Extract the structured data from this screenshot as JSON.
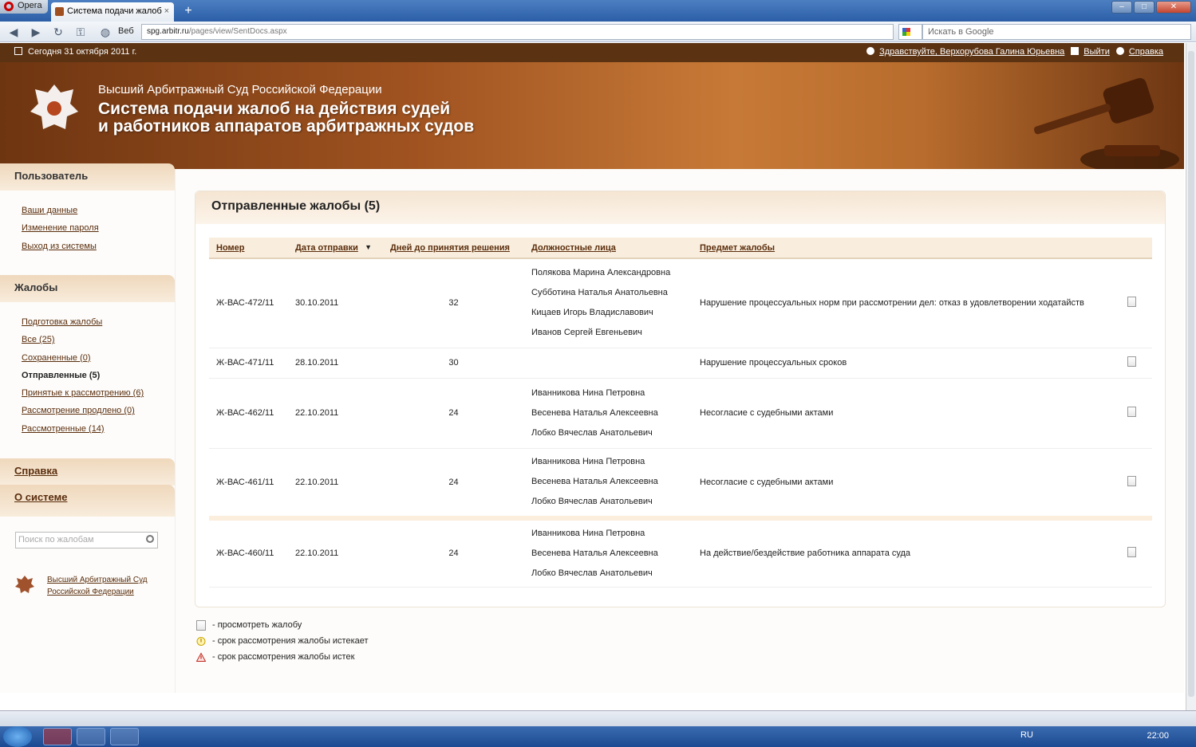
{
  "browser": {
    "menu_label": "Opera",
    "tab_title": "Система подачи жалоб",
    "web_label": "Веб",
    "url_host": "spg.arbitr.ru",
    "url_path": "/pages/view/SentDocs.aspx",
    "search_placeholder": "Искать в Google"
  },
  "topbar": {
    "date": "Сегодня 31 октября 2011 г.",
    "greeting": "Здравствуйте, Верхорубова Галина Юрьевна",
    "logout": "Выйти",
    "help": "Справка"
  },
  "banner": {
    "court": "Высший Арбитражный Суд Российской Федерации",
    "title_line1": "Система подачи жалоб на действия судей",
    "title_line2": "и работников аппаратов арбитражных судов"
  },
  "sidebar": {
    "user_header": "Пользователь",
    "user_links": [
      "Ваши данные",
      "Изменение пароля",
      "Выход из системы"
    ],
    "complaints_header": "Жалобы",
    "complaint_links": [
      "Подготовка жалобы",
      "Все (25)",
      "Сохраненные (0)",
      "Отправленные (5)",
      "Принятые к рассмотрению (6)",
      "Рассмотрение продлено (0)",
      "Рассмотренные (14)"
    ],
    "help_header": "Справка",
    "about_header": "О системе",
    "search_placeholder": "Поиск по жалобам",
    "court_link_line1": "Высший Арбитражный Суд",
    "court_link_line2": "Российской Федерации"
  },
  "panel": {
    "title": "Отправленные жалобы (5)",
    "columns": [
      "Номер",
      "Дата отправки",
      "Дней до принятия решения",
      "Должностные лица",
      "Предмет жалобы"
    ],
    "sort_indicator": "▼",
    "rows": [
      {
        "number": "Ж-ВАС-472/11",
        "date": "30.10.2011",
        "days": "32",
        "officials": [
          "Полякова Марина Александровна",
          "Субботина Наталья Анатольевна",
          "Кицаев Игорь Владиславович",
          "Иванов Сергей Евгеньевич"
        ],
        "subject": "Нарушение процессуальных норм при рассмотрении дел: отказ в удовлетворении ходатайств"
      },
      {
        "number": "Ж-ВАС-471/11",
        "date": "28.10.2011",
        "days": "30",
        "officials": [],
        "subject": "Нарушение процессуальных сроков"
      },
      {
        "number": "Ж-ВАС-462/11",
        "date": "22.10.2011",
        "days": "24",
        "officials": [
          "Иванникова Нина Петровна",
          "Весенева Наталья Алексеевна",
          "Лобко Вячеслав Анатольевич"
        ],
        "subject": "Несогласие с судебными актами"
      },
      {
        "number": "Ж-ВАС-461/11",
        "date": "22.10.2011",
        "days": "24",
        "officials": [
          "Иванникова Нина Петровна",
          "Весенева Наталья Алексеевна",
          "Лобко Вячеслав Анатольевич"
        ],
        "subject": "Несогласие с судебными актами"
      },
      {
        "number": "Ж-ВАС-460/11",
        "date": "22.10.2011",
        "days": "24",
        "officials": [
          "Иванникова Нина Петровна",
          "Весенева Наталья Алексеевна",
          "Лобко Вячеслав Анатольевич"
        ],
        "subject": "На действие/бездействие работника аппарата суда"
      }
    ]
  },
  "legend": [
    {
      "icon": "document-icon",
      "text": "- просмотреть жалобу"
    },
    {
      "icon": "warning-clock-icon",
      "text": "- срок рассмотрения жалобы истекает"
    },
    {
      "icon": "alert-triangle-icon",
      "text": "- срок рассмотрения жалобы истек"
    }
  ],
  "taskbar": {
    "lang": "RU",
    "clock": "22:00"
  },
  "colors": {
    "brand_brown": "#5b3212",
    "link": "#5a2d0c",
    "header_beige": "#f5e5d2"
  }
}
